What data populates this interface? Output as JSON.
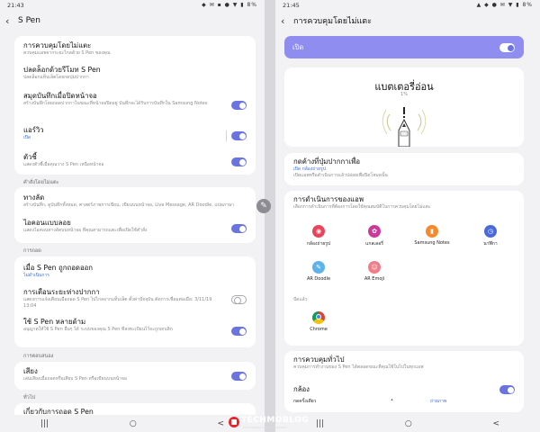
{
  "left": {
    "status": {
      "time": "21:43",
      "icons": "◆ ✉ ▪ ●  ▼ ▮ 8%"
    },
    "title": "S Pen",
    "card1": {
      "items": [
        {
          "title": "การควบคุมโดยไม่แตะ",
          "sub": "ควบคุมแอพจากระยะไกลด้วย S Pen ของคุณ",
          "toggle": null
        },
        {
          "title": "ปลดล็อกด้วยรีโมท S Pen",
          "sub": "ปลดล็อกแท็บเล็ตโดยกดปุ่มปากกา",
          "toggle": null
        },
        {
          "title": "สมุดบันทึกเมื่อปิดหน้าจอ",
          "sub": "สร้างบันทึกโดยถอดปากกาในขณะที่หน้าจอปิดอยู่ บันทึกจะได้รับการบันทึกใน Samsung Notes",
          "toggle": "on"
        },
        {
          "title": "แอร์วิว",
          "sub": "เปิด",
          "sub_blue": true,
          "toggle": "on"
        },
        {
          "title": "ตัวชี้",
          "sub": "แสดงตัวชี้เมื่อคุณวาง S Pen เหนือหน้าจอ",
          "toggle": "on"
        }
      ]
    },
    "section_airmenu": "คำสั่งโดยไม่แตะ",
    "card2": {
      "items": [
        {
          "title": "ทางลัด",
          "sub": "สร้างบันทึก, ดูบันทึกทั้งหมด, ศาสตร์ภาพการเขียน, เขียนบนหน้าจอ, Live Message, AR Doodle, แปลภาษา",
          "toggle": null
        },
        {
          "title": "ไอคอนแบบลอย",
          "sub": "แสดงไอคอนทางลัดบนหน้าจอ ที่คุณสามารถแตะเพื่อเปิดใช้คำสั่ง",
          "toggle": "on"
        }
      ]
    },
    "section_remove": "การถอด",
    "card3": {
      "items": [
        {
          "title": "เมื่อ S Pen ถูกถอดออก",
          "sub": "ไม่ดำเนินการ",
          "sub_blue": true,
          "toggle": null
        },
        {
          "title": "การเตือนระยะห่างปากกา",
          "sub": "แสดงการแจ้งเตือนเมื่อถอด S Pen ไปไกลจากแท็บเล็ต ตั้งค่าปัจจุบัน ตัดการเชื่อมต่อเมื่อ: 3/11/19 13:04",
          "toggle": "off"
        },
        {
          "title": "ใช้ S Pen หลายด้าม",
          "sub": "อนุญาตให้ใช้ S Pen อื่นๆ ได้ ระบบของคุณ S Pen ที่ลงทะเบียนไว้จะถูกยกเลิก",
          "toggle": "on"
        }
      ]
    },
    "section_feedback": "การตอบสนอง",
    "card4": {
      "items": [
        {
          "title": "เสียง",
          "sub": "เล่นเสียงเมื่อถอดหรือเสียบ S Pen หรือเขียนบนหน้าจอ",
          "toggle": "on"
        }
      ]
    },
    "section_general": "ทั่วไป",
    "card5_partial": "เกี่ยวกับการถอด S Pen"
  },
  "right": {
    "status": {
      "time": "21:45",
      "icons": "▲ ◆ ● ✉  ▼ ▮ 8%"
    },
    "title": "การควบคุมโดยไม่แตะ",
    "on_label": "เปิด",
    "battery": {
      "title": "แบตเตอรี่อ่อน",
      "percent": "1%"
    },
    "press_hold": {
      "title": "กดค้างที่ปุ่มปากกาเพื่อ",
      "value": "เปิด กล้องถ่ายรูป",
      "sub": "เปิดแอพหรือดำเนินการแล้วปล่อยเพื่อปิดโหมดนั้น"
    },
    "app_actions": {
      "title": "การดำเนินการของแอพ",
      "sub": "เลือกการดำเนินการที่ต้องการโดยใช้คุณสมบัติในการควบคุมโดยไม่แตะ",
      "apps": [
        {
          "name": "กล้องถ่ายรูป",
          "color": "#e9445b",
          "glyph": "◉"
        },
        {
          "name": "แกลเลอรี่",
          "color": "#c93a9a",
          "glyph": "✿"
        },
        {
          "name": "Samsung Notes",
          "color": "#f58a2c",
          "glyph": "▮"
        },
        {
          "name": "นาฬิกา",
          "color": "#4a6ad8",
          "glyph": "◷"
        },
        {
          "name": "AR Doodle",
          "color": "#5fb3e6",
          "glyph": "✎"
        },
        {
          "name": "AR Emoji",
          "color": "#f07e86",
          "glyph": "☺"
        }
      ],
      "recent_label": "ปัดแล้ว",
      "recent_apps": [
        {
          "name": "Chrome"
        }
      ]
    },
    "general": {
      "title": "การควบคุมทั่วไป",
      "sub": "ควบคุมการทำงานของ S Pen ได้ตลอดขณะที่คุณใช้ในไปในทุกแอพ",
      "camera_label": "กล้อง",
      "press_label": "กดครั้งเดียว",
      "press_value": "ถ่ายภาพ"
    }
  },
  "watermark": {
    "title": "TECHMOBLOG",
    "tagline": "technology inspire business"
  },
  "nav": {
    "recents": "|||",
    "home": "○",
    "back": "<"
  }
}
